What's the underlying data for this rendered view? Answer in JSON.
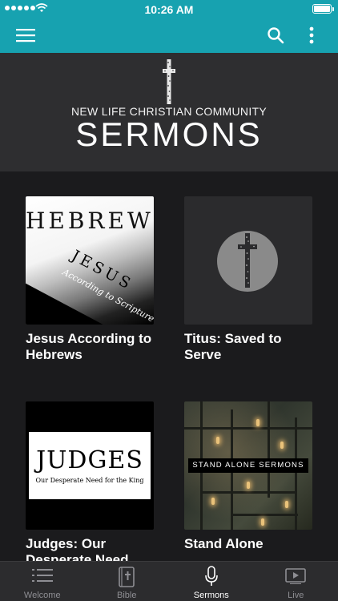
{
  "status_bar": {
    "time": "10:26 AM"
  },
  "banner": {
    "community": "NEW LIFE CHRISTIAN COMMUNITY",
    "title": "SERMONS"
  },
  "series": [
    {
      "title": "Jesus According to Hebrews",
      "art": {
        "heading": "HEBREWS",
        "name": "JESUS",
        "subtitle": "According to Scripture"
      }
    },
    {
      "title": "Titus: Saved to Serve",
      "art": {}
    },
    {
      "title": "Judges: Our Desperate Need",
      "art": {
        "heading": "JUDGES",
        "subtitle": "Our Desperate Need for the King"
      }
    },
    {
      "title": "Stand Alone",
      "art": {
        "label": "STAND ALONE SERMONS"
      }
    }
  ],
  "tabs": [
    {
      "label": "Welcome",
      "icon": "list-icon",
      "active": false
    },
    {
      "label": "Bible",
      "icon": "bible-icon",
      "active": false
    },
    {
      "label": "Sermons",
      "icon": "microphone-icon",
      "active": true
    },
    {
      "label": "Live",
      "icon": "play-icon",
      "active": false
    }
  ],
  "colors": {
    "accent": "#17a2b0",
    "background": "#1b1b1d",
    "banner": "#2e2e30"
  }
}
